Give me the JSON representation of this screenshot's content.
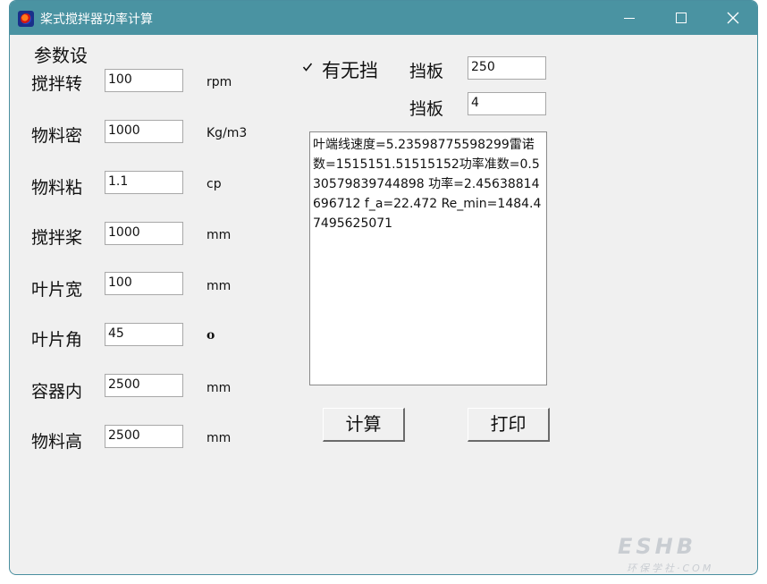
{
  "window": {
    "title": "桨式搅拌器功率计算"
  },
  "params": {
    "section_title": "参数设",
    "rows": [
      {
        "label": "搅拌转",
        "value": "100",
        "unit": "rpm"
      },
      {
        "label": "物料密",
        "value": "1000",
        "unit": "Kg/m3"
      },
      {
        "label": "物料粘",
        "value": "1.1",
        "unit": "cp"
      },
      {
        "label": "搅拌桨",
        "value": "1000",
        "unit": "mm"
      },
      {
        "label": "叶片宽",
        "value": "100",
        "unit": "mm"
      },
      {
        "label": "叶片角",
        "value": "45",
        "unit": "o"
      },
      {
        "label": "容器内",
        "value": "2500",
        "unit": "mm"
      },
      {
        "label": "物料高",
        "value": "2500",
        "unit": "mm"
      }
    ]
  },
  "baffle": {
    "checked": true,
    "check_label": "有无挡",
    "width_label": "挡板",
    "width_value": "250",
    "count_label": "挡板",
    "count_value": "4"
  },
  "result": {
    "text": "叶端线速度=5.23598775598299雷诺数=1515151.51515152功率准数=0.530579839744898      功率=2.45638814696712   f_a=22.472 Re_min=1484.47495625071"
  },
  "buttons": {
    "calc": "计算",
    "print": "打印"
  },
  "watermark": {
    "main": "ESHB",
    "sub": "环保学社·COM"
  }
}
